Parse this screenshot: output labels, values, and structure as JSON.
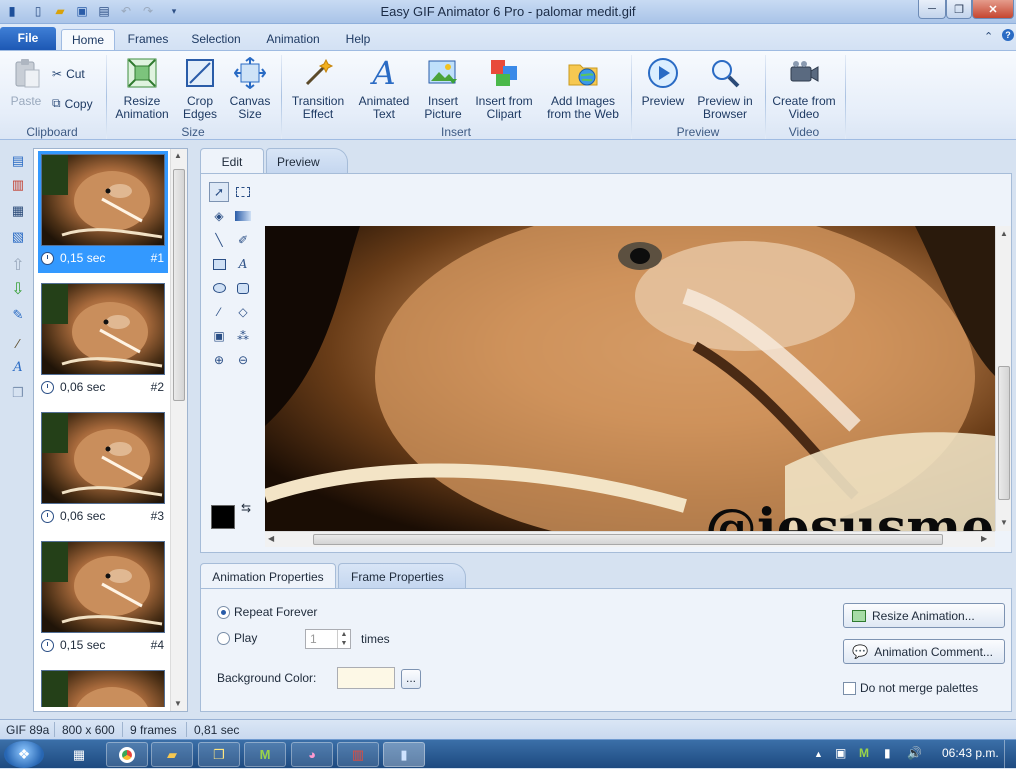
{
  "window": {
    "title": "Easy GIF Animator 6 Pro - palomar medit.gif",
    "minimize": "─",
    "maximize": "❐",
    "close": "✕"
  },
  "ribbon_tabs": {
    "file": "File",
    "items": [
      "Home",
      "Frames",
      "Selection",
      "Animation",
      "Help"
    ]
  },
  "clipboard": {
    "paste": "Paste",
    "cut": "Cut",
    "copy": "Copy",
    "group": "Clipboard"
  },
  "size": {
    "resize": "Resize Animation",
    "crop": "Crop Edges",
    "canvas": "Canvas Size",
    "group": "Size"
  },
  "insert": {
    "transition": "Transition Effect",
    "animated_text": "Animated Text",
    "picture": "Insert Picture",
    "clipart": "Insert from Clipart",
    "web": "Add Images from the Web",
    "group": "Insert"
  },
  "preview_group": {
    "preview": "Preview",
    "browser": "Preview in Browser",
    "group": "Preview"
  },
  "video_group": {
    "create": "Create from Video",
    "group": "Video"
  },
  "frames": [
    {
      "time": "0,15 sec",
      "num": "#1"
    },
    {
      "time": "0,06 sec",
      "num": "#2"
    },
    {
      "time": "0,06 sec",
      "num": "#3"
    },
    {
      "time": "0,15 sec",
      "num": "#4"
    }
  ],
  "editor_tabs": {
    "edit": "Edit",
    "preview": "Preview"
  },
  "canvas_watermark": "@iesusmed",
  "prop_tabs": {
    "animation": "Animation Properties",
    "frame": "Frame Properties"
  },
  "props": {
    "repeat_forever": "Repeat Forever",
    "play": "Play",
    "play_count": "1",
    "times": "times",
    "bg_label": "Background Color:",
    "bg_color": "#fdf8e6",
    "browse": "...",
    "resize_btn": "Resize Animation...",
    "comment_btn": "Animation Comment...",
    "merge": "Do not merge palettes"
  },
  "status": {
    "format": "GIF 89a",
    "dimensions": "800 x 600",
    "frames": "9 frames",
    "duration": "0,81 sec"
  },
  "taskbar": {
    "time": "06:43 p.m."
  }
}
